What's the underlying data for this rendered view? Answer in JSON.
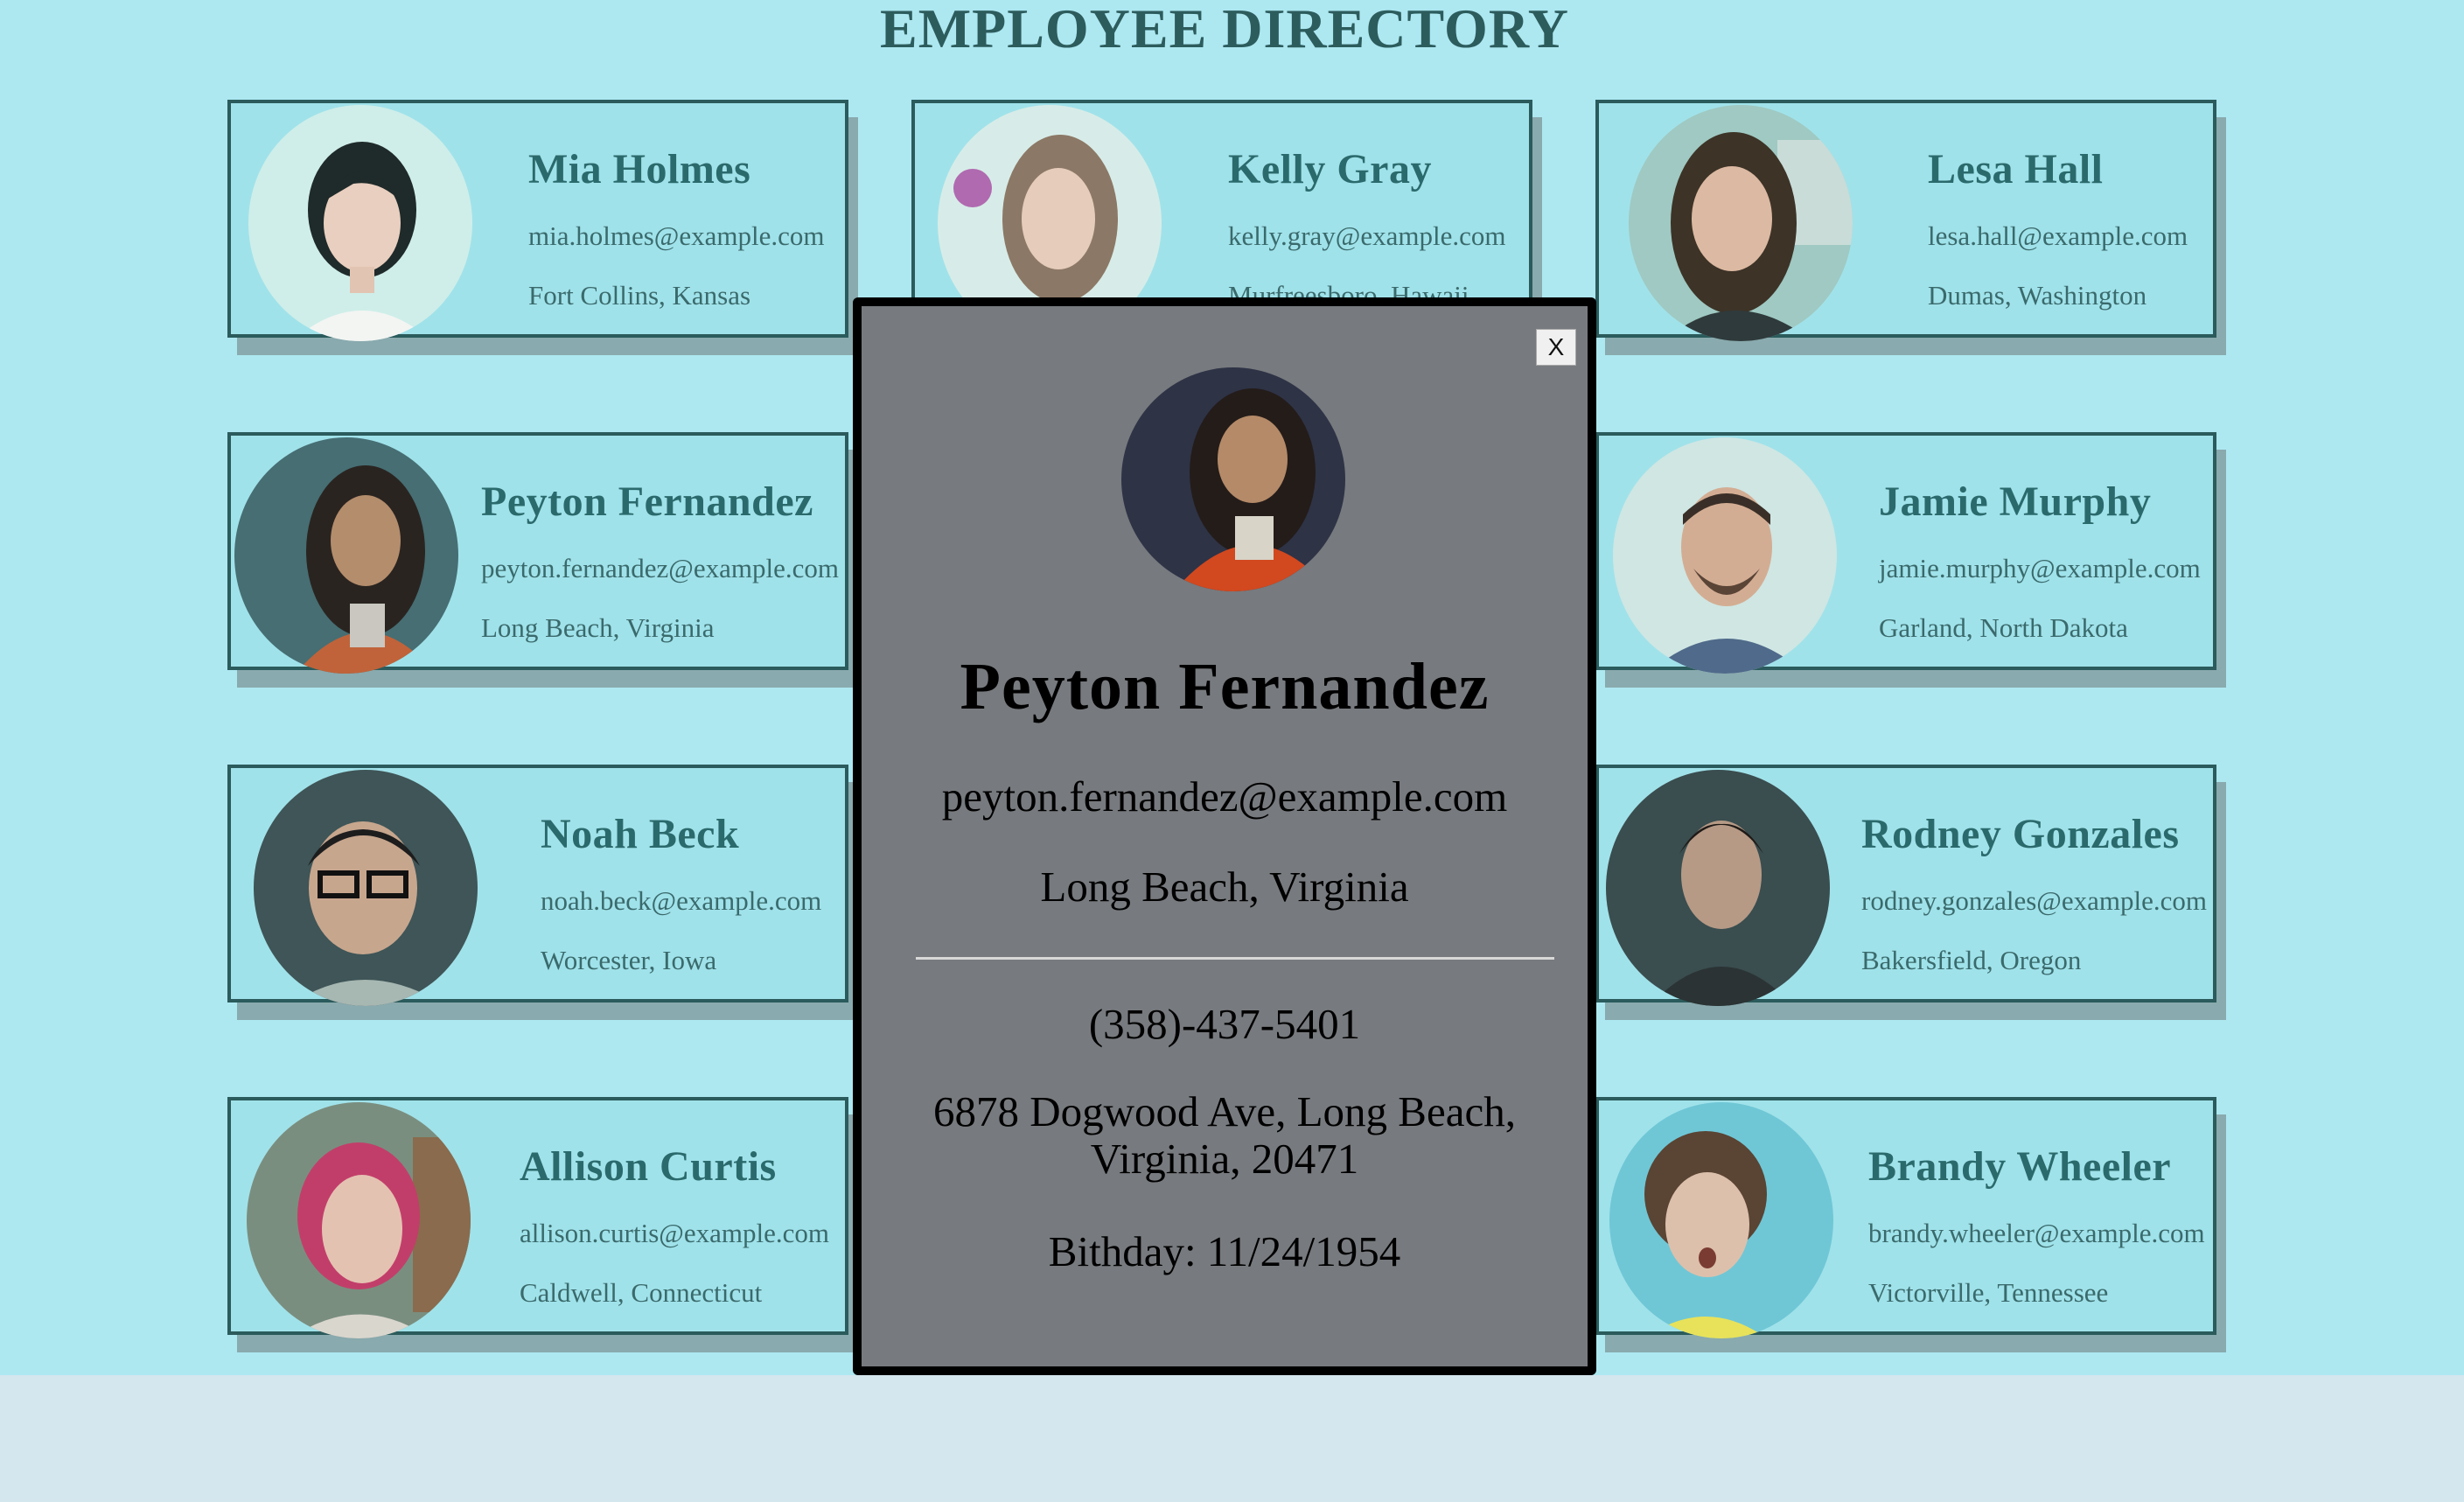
{
  "page": {
    "title": "EMPLOYEE DIRECTORY"
  },
  "employees": [
    {
      "name": "Mia Holmes",
      "email": "mia.holmes@example.com",
      "location": "Fort Collins, Kansas"
    },
    {
      "name": "Kelly Gray",
      "email": "kelly.gray@example.com",
      "location": "Murfreesboro, Hawaii"
    },
    {
      "name": "Lesa Hall",
      "email": "lesa.hall@example.com",
      "location": "Dumas, Washington"
    },
    {
      "name": "Peyton Fernandez",
      "email": "peyton.fernandez@example.com",
      "location": "Long Beach, Virginia"
    },
    {
      "name": "",
      "email": "",
      "location": ""
    },
    {
      "name": "Jamie Murphy",
      "email": "jamie.murphy@example.com",
      "location": "Garland, North Dakota"
    },
    {
      "name": "Noah Beck",
      "email": "noah.beck@example.com",
      "location": "Worcester, Iowa"
    },
    {
      "name": "",
      "email": "",
      "location": ""
    },
    {
      "name": "Rodney Gonzales",
      "email": "rodney.gonzales@example.com",
      "location": "Bakersfield, Oregon"
    },
    {
      "name": "Allison Curtis",
      "email": "allison.curtis@example.com",
      "location": "Caldwell, Connecticut"
    },
    {
      "name": "",
      "email": "",
      "location": ""
    },
    {
      "name": "Brandy Wheeler",
      "email": "brandy.wheeler@example.com",
      "location": "Victorville, Tennessee"
    }
  ],
  "modal": {
    "close_label": "X",
    "name": "Peyton Fernandez",
    "email": "peyton.fernandez@example.com",
    "location": "Long Beach, Virginia",
    "phone": "(358)-437-5401",
    "address": "6878 Dogwood Ave, Long Beach, Virginia, 20471",
    "birthday": "Bithday: 11/24/1954"
  },
  "colors": {
    "page_bg": "#ade8f1",
    "card_bg": "#a0e2ea",
    "card_border": "#2b5b5c",
    "card_text": "#2b6a6c",
    "modal_bg": "#777a7e",
    "modal_border": "#000000"
  }
}
